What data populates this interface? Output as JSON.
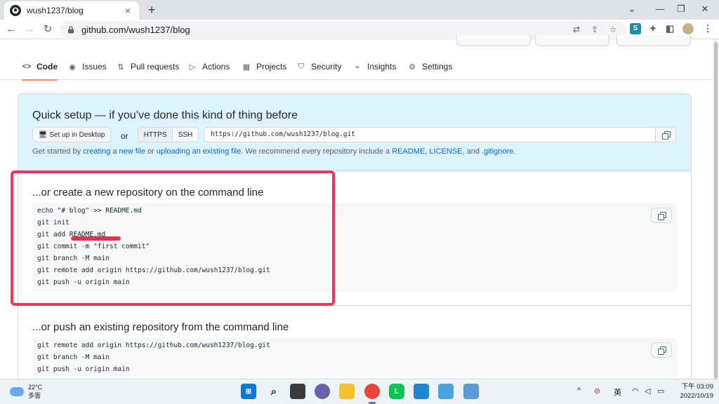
{
  "browser": {
    "tab_title": "wush1237/blog",
    "tab_close": "×",
    "new_tab": "+",
    "url": "github.com/wush1237/blog",
    "window_controls": [
      "⌄",
      "—",
      "❐",
      "✕"
    ]
  },
  "repo_nav": {
    "items": [
      {
        "label": "Code",
        "icon": "code-icon"
      },
      {
        "label": "Issues",
        "icon": "issue-icon"
      },
      {
        "label": "Pull requests",
        "icon": "pull-request-icon"
      },
      {
        "label": "Actions",
        "icon": "play-icon"
      },
      {
        "label": "Projects",
        "icon": "table-icon"
      },
      {
        "label": "Security",
        "icon": "shield-icon"
      },
      {
        "label": "Insights",
        "icon": "graph-icon"
      },
      {
        "label": "Settings",
        "icon": "gear-icon"
      }
    ]
  },
  "quick_setup": {
    "title": "Quick setup — if you’ve done this kind of thing before",
    "desktop_button": "Set up in Desktop",
    "or": "or",
    "https": "HTTPS",
    "ssh": "SSH",
    "clone_url": "https://github.com/wush1237/blog.git",
    "get_started_prefix": "Get started by",
    "link_create_file": "creating a new file",
    "or_text": "or",
    "link_upload": "uploading an existing file",
    "recommend_text": ". We recommend every repository include a",
    "link_readme": "README",
    "link_license": "LICENSE",
    "and_text": ", and",
    "link_gitignore": ".gitignore",
    "comma": ",",
    "period": "."
  },
  "new_repo": {
    "title": "...or create a new repository on the command line",
    "lines": [
      "echo \"# blog\" >> README.md",
      "git init",
      "git add README.md",
      "git commit -m \"first commit\"",
      "git branch -M main",
      "git remote add origin https://github.com/wush1237/blog.git",
      "git push -u origin main"
    ]
  },
  "push_existing": {
    "title": "...or push an existing repository from the command line",
    "lines": [
      "git remote add origin https://github.com/wush1237/blog.git",
      "git branch -M main",
      "git push -u origin main"
    ]
  },
  "taskbar": {
    "temperature": "22°C",
    "weather": "多雲",
    "ime": "英",
    "time_period": "下午 03:09",
    "date": "2022/10/19",
    "chevron": "^"
  },
  "colors": {
    "accent": "#0969da",
    "highlight_box": "#f03657",
    "quick_setup_bg": "#ddf4ff",
    "active_tab_underline": "#fd8c73"
  }
}
